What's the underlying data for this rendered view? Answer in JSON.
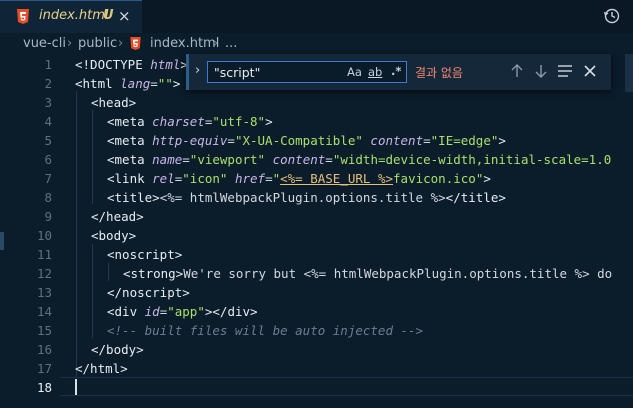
{
  "tab": {
    "icon": "html5-icon",
    "filename": "index.html",
    "status": "U",
    "close": "×"
  },
  "toolbar": {
    "history_icon": "history-icon"
  },
  "breadcrumb": {
    "items": [
      "vue-cli",
      "public",
      "index.html",
      "..."
    ],
    "separator": "›"
  },
  "gutter": {
    "line_numbers": [
      "1",
      "2",
      "3",
      "4",
      "5",
      "6",
      "7",
      "8",
      "9",
      "10",
      "11",
      "12",
      "13",
      "14",
      "15",
      "16",
      "17",
      "18"
    ],
    "active_line": "18"
  },
  "code": {
    "l1": {
      "a": "<!DOCTYPE ",
      "b": "html",
      "c": ">"
    },
    "l2": {
      "a": "<html ",
      "b": "lang",
      "c": "=",
      "d": "\"\"",
      "e": ">"
    },
    "l3": {
      "a": "<head>"
    },
    "l4": {
      "a": "<meta ",
      "b": "charset",
      "c": "=",
      "d": "\"utf-8\"",
      "e": ">"
    },
    "l5": {
      "a": "<meta ",
      "b": "http-equiv",
      "c": "=",
      "d": "\"X-UA-Compatible\"",
      "e": " ",
      "f": "content",
      "g": "=",
      "h": "\"IE=edge\"",
      "i": ">"
    },
    "l6": {
      "a": "<meta ",
      "b": "name",
      "c": "=",
      "d": "\"viewport\"",
      "e": " ",
      "f": "content",
      "g": "=",
      "h": "\"width=device-width,initial-scale=1.0"
    },
    "l7": {
      "a": "<link ",
      "b": "rel",
      "c": "=",
      "d": "\"icon\"",
      "e": " ",
      "f": "href",
      "g": "=",
      "h": "\"",
      "i": "<%= BASE_URL %>",
      "j": "favicon.ico",
      "k": "\"",
      "l": ">"
    },
    "l8": {
      "a": "<title>",
      "b": "<%= htmlWebpackPlugin.options.title %>",
      "c": "</title>"
    },
    "l9": {
      "a": "</head>"
    },
    "l10": {
      "a": "<body>"
    },
    "l11": {
      "a": "<noscript>"
    },
    "l12": {
      "a": "<strong>",
      "b": "We're sorry but <%= htmlWebpackPlugin.options.title %> do"
    },
    "l13": {
      "a": "</noscript>"
    },
    "l14": {
      "a": "<div ",
      "b": "id",
      "c": "=",
      "d": "\"app\"",
      "e": "></div>"
    },
    "l15": {
      "a": "<!-- built files will be auto injected -->"
    },
    "l16": {
      "a": "</body>"
    },
    "l17": {
      "a": "</html>"
    },
    "l18": {
      "a": ""
    }
  },
  "find": {
    "expander": "›",
    "query": "\"script\"",
    "match_case_label": "Aa",
    "whole_word_label": "ab",
    "regex_label": ".*",
    "result_text": "결과 없음",
    "prev_icon": "arrow-up-icon",
    "next_icon": "arrow-down-icon",
    "selection_icon": "find-in-selection-icon",
    "close_icon": "close-icon"
  },
  "colors": {
    "background": "#0b1c2b",
    "tab_label": "#e7d48a",
    "string": "#a8e06a",
    "attribute": "#c9b6e8",
    "no_results": "#f48771"
  }
}
